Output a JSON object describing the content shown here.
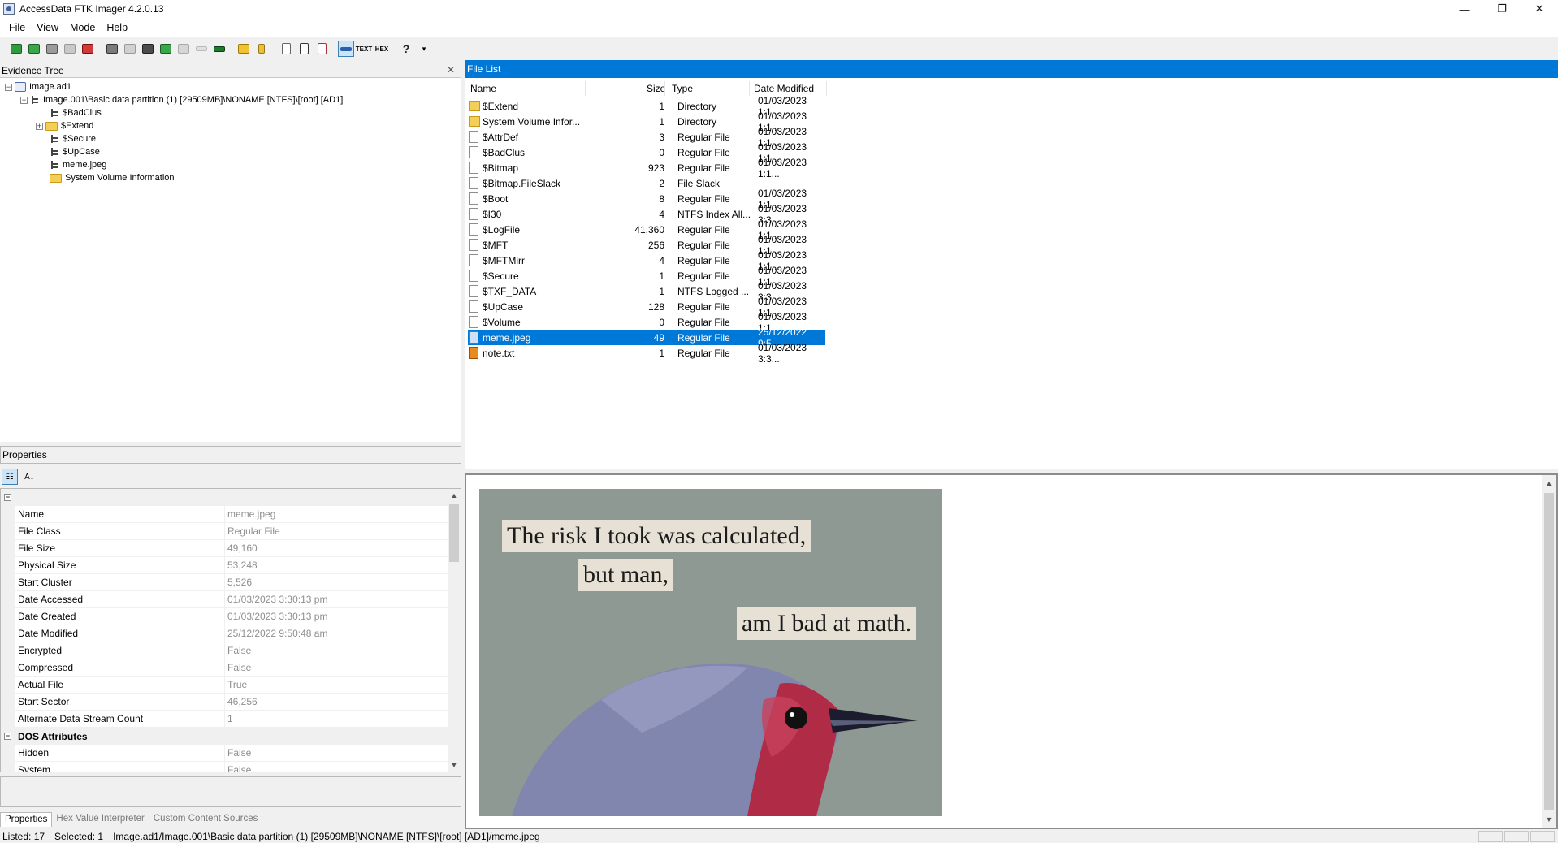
{
  "window": {
    "title": "AccessData FTK Imager 4.2.0.13",
    "controls": {
      "minimize": "—",
      "restore": "❐",
      "close": "✕"
    }
  },
  "menu": [
    {
      "label": "File",
      "accel": "F",
      "rest": "ile"
    },
    {
      "label": "View",
      "accel": "V",
      "rest": "iew"
    },
    {
      "label": "Mode",
      "accel": "M",
      "rest": "ode"
    },
    {
      "label": "Help",
      "accel": "H",
      "rest": "elp"
    }
  ],
  "toolbar": {
    "icons": [
      "add-evidence-icon",
      "add-all-evidence-icon",
      "image-mounting-icon",
      "remove-evidence-icon",
      "remove-all-evidence-icon",
      "create-disk-image-icon",
      "export-disk-image-icon",
      "export-logical-image-icon",
      "add-to-custom-content-icon",
      "create-custom-content-icon",
      "decrypt-icon",
      "verify-drive-icon",
      "capture-memory-icon",
      "obtain-protected-files-icon",
      "detect-efs-icon",
      "export-files-icon",
      "export-hash-list-icon",
      "view-auto-icon",
      "view-text-icon",
      "view-hex-icon",
      "help-icon",
      "more-icon"
    ],
    "accent": "#3c7fb1"
  },
  "evidence_tree": {
    "title": "Evidence Tree",
    "close_glyph": "✕",
    "nodes": [
      {
        "label": "Image.ad1"
      },
      {
        "label": "Image.001\\Basic data partition (1) [29509MB]\\NONAME [NTFS]\\[root] [AD1]"
      },
      {
        "label": "$BadClus"
      },
      {
        "label": "$Extend"
      },
      {
        "label": "$Secure"
      },
      {
        "label": "$UpCase"
      },
      {
        "label": "meme.jpeg"
      },
      {
        "label": "System Volume Information"
      }
    ],
    "expanders": {
      "collapse": "−",
      "expand": "+"
    }
  },
  "properties": {
    "title": "Properties",
    "sort_categorized_glyph": "☷",
    "sort_alpha_glyph": "A↓",
    "collapse_glyph": "−",
    "rows": [
      {
        "name": "Name",
        "value": "meme.jpeg"
      },
      {
        "name": "File Class",
        "value": "Regular File"
      },
      {
        "name": "File Size",
        "value": "49,160"
      },
      {
        "name": "Physical Size",
        "value": "53,248"
      },
      {
        "name": "Start Cluster",
        "value": "5,526"
      },
      {
        "name": "Date Accessed",
        "value": "01/03/2023 3:30:13 pm"
      },
      {
        "name": "Date Created",
        "value": "01/03/2023 3:30:13 pm"
      },
      {
        "name": "Date Modified",
        "value": "25/12/2022 9:50:48 am"
      },
      {
        "name": "Encrypted",
        "value": "False"
      },
      {
        "name": "Compressed",
        "value": "False"
      },
      {
        "name": "Actual File",
        "value": "True"
      },
      {
        "name": "Start Sector",
        "value": "46,256"
      },
      {
        "name": "Alternate Data Stream Count",
        "value": "1"
      }
    ],
    "dos_category": "DOS Attributes",
    "dos_rows": [
      {
        "name": "Hidden",
        "value": "False"
      },
      {
        "name": "System",
        "value": "False"
      }
    ],
    "tabs": [
      "Properties",
      "Hex Value Interpreter",
      "Custom Content Sources"
    ]
  },
  "file_list": {
    "title": "File List",
    "columns": {
      "name": "Name",
      "size": "Size",
      "type": "Type",
      "date": "Date Modified"
    },
    "rows": [
      {
        "icon": "folder",
        "name": "$Extend",
        "size": "1",
        "type": "Directory",
        "date": "01/03/2023 1:1..."
      },
      {
        "icon": "folder",
        "name": "System Volume Infor...",
        "size": "1",
        "type": "Directory",
        "date": "01/03/2023 1:1..."
      },
      {
        "icon": "file",
        "name": "$AttrDef",
        "size": "3",
        "type": "Regular File",
        "date": "01/03/2023 1:1..."
      },
      {
        "icon": "file",
        "name": "$BadClus",
        "size": "0",
        "type": "Regular File",
        "date": "01/03/2023 1:1..."
      },
      {
        "icon": "file",
        "name": "$Bitmap",
        "size": "923",
        "type": "Regular File",
        "date": "01/03/2023 1:1..."
      },
      {
        "icon": "file",
        "name": "$Bitmap.FileSlack",
        "size": "2",
        "type": "File Slack",
        "date": ""
      },
      {
        "icon": "file",
        "name": "$Boot",
        "size": "8",
        "type": "Regular File",
        "date": "01/03/2023 1:1..."
      },
      {
        "icon": "file",
        "name": "$I30",
        "size": "4",
        "type": "NTFS Index All...",
        "date": "01/03/2023 3:3..."
      },
      {
        "icon": "file",
        "name": "$LogFile",
        "size": "41,360",
        "type": "Regular File",
        "date": "01/03/2023 1:1..."
      },
      {
        "icon": "file",
        "name": "$MFT",
        "size": "256",
        "type": "Regular File",
        "date": "01/03/2023 1:1..."
      },
      {
        "icon": "file",
        "name": "$MFTMirr",
        "size": "4",
        "type": "Regular File",
        "date": "01/03/2023 1:1..."
      },
      {
        "icon": "file",
        "name": "$Secure",
        "size": "1",
        "type": "Regular File",
        "date": "01/03/2023 1:1..."
      },
      {
        "icon": "file",
        "name": "$TXF_DATA",
        "size": "1",
        "type": "NTFS Logged ...",
        "date": "01/03/2023 3:3..."
      },
      {
        "icon": "file",
        "name": "$UpCase",
        "size": "128",
        "type": "Regular File",
        "date": "01/03/2023 1:1..."
      },
      {
        "icon": "file",
        "name": "$Volume",
        "size": "0",
        "type": "Regular File",
        "date": "01/03/2023 1:1..."
      },
      {
        "icon": "image",
        "name": "meme.jpeg",
        "size": "49",
        "type": "Regular File",
        "date": "25/12/2022 9:5...",
        "selected": true
      },
      {
        "icon": "txt",
        "name": "note.txt",
        "size": "1",
        "type": "Regular File",
        "date": "01/03/2023 3:3..."
      }
    ],
    "header_color": "#0078d7",
    "selection_color": "#0078d7"
  },
  "viewer": {
    "meme_lines": [
      "The risk I took was calculated,",
      "but man,",
      "am I bad at math."
    ],
    "scroll_up": "▲",
    "scroll_down": "▼"
  },
  "statusbar": {
    "listed": "Listed: 17",
    "selected": "Selected: 1",
    "path": "Image.ad1/Image.001\\Basic data partition (1) [29509MB]\\NONAME [NTFS]\\[root] [AD1]/meme.jpeg"
  }
}
